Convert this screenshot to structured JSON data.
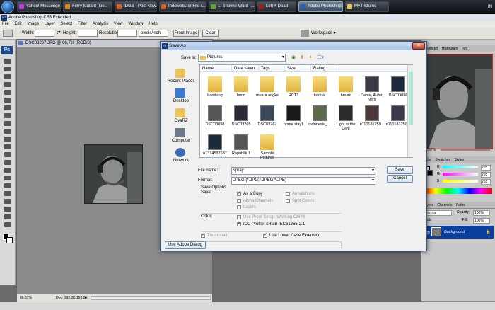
{
  "taskbar": {
    "buttons": [
      {
        "label": "Yahoo! Messenger",
        "color": "#c43ad6"
      },
      {
        "label": "Ferry Mutant (loe...",
        "color": "#e08a20"
      },
      {
        "label": "IDGS - Post New T...",
        "color": "#e06020"
      },
      {
        "label": "Indowebster File s...",
        "color": "#e06020"
      },
      {
        "label": "1. Shayne Ward -...",
        "color": "#60a030"
      },
      {
        "label": "Left 4 Dead",
        "color": "#a02020"
      },
      {
        "label": "Adobe Photoshop...",
        "color": "#2a5fb0"
      },
      {
        "label": "My Pictures",
        "color": "#e8c65a"
      }
    ],
    "tray": "IN"
  },
  "app": {
    "title": "Adobe Photoshop CS3 Extended",
    "menu": [
      "File",
      "Edit",
      "Image",
      "Layer",
      "Select",
      "Filter",
      "Analysis",
      "View",
      "Window",
      "Help"
    ],
    "options": {
      "width_label": "Width:",
      "height_label": "Height:",
      "resolution_label": "Resolution:",
      "resolution_unit": "pixels/inch",
      "front_image": "Front Image",
      "clear": "Clear",
      "workspace": "Workspace ▾"
    }
  },
  "document": {
    "title": "DSC03267.JPG @ 66,7% (RGB/8)",
    "zoom": "66,67%",
    "doc_info": "Doc: 192,0K/192,0K"
  },
  "panels": {
    "navigator_tabs": [
      "Navigator",
      "Histogram",
      "Info"
    ],
    "navigator_zoom": "66,67%",
    "color_tabs": [
      "Color",
      "Swatches",
      "Styles"
    ],
    "color_values": [
      {
        "channel": "R",
        "value": "255"
      },
      {
        "channel": "G",
        "value": "255"
      },
      {
        "channel": "B",
        "value": "255"
      }
    ],
    "layer_tabs": [
      "Layers",
      "Channels",
      "Paths"
    ],
    "layer_mode": "Normal",
    "opacity_label": "Opacity:",
    "opacity_value": "100%",
    "lock_label": "Lock:",
    "fill_label": "Fill:",
    "fill_value": "100%",
    "layer_name": "Background"
  },
  "dialog": {
    "title": "Save As",
    "save_in_label": "Save in:",
    "save_in_value": "Pictures",
    "places": [
      "Recent Places",
      "Desktop",
      "OvaRZ",
      "Computer",
      "Network"
    ],
    "columns": [
      "Name",
      "Date taken",
      "Tags",
      "Size",
      "Rating"
    ],
    "files": [
      {
        "name": "bandung",
        "kind": "folder"
      },
      {
        "name": "hmm",
        "kind": "folder"
      },
      {
        "name": "muara angke",
        "kind": "folder"
      },
      {
        "name": "RCT3",
        "kind": "folder"
      },
      {
        "name": "tutorial",
        "kind": "folder"
      },
      {
        "name": "tweak",
        "kind": "folder"
      },
      {
        "name": "Dante, Aufar, Nero",
        "kind": "photo"
      },
      {
        "name": "DSC03096",
        "kind": "photo"
      },
      {
        "name": "DSC03098",
        "kind": "photo"
      },
      {
        "name": "DSC03265",
        "kind": "photo"
      },
      {
        "name": "DSC03267",
        "kind": "photo"
      },
      {
        "name": "home stay1",
        "kind": "photo"
      },
      {
        "name": "indonesia_...",
        "kind": "photo"
      },
      {
        "name": "Light in the Dark",
        "kind": "photo"
      },
      {
        "name": "n110181259...",
        "kind": "photo"
      },
      {
        "name": "n110181259...",
        "kind": "photo"
      },
      {
        "name": "n1314537687",
        "kind": "photo"
      },
      {
        "name": "Republik 1",
        "kind": "photo"
      },
      {
        "name": "Sample Pictures",
        "kind": "folder"
      }
    ],
    "file_name_label": "File name:",
    "file_name_value": "spray",
    "format_label": "Format:",
    "format_value": "JPEG (*.JPG;*.JPEG;*.JPE)",
    "save": "Save",
    "cancel": "Cancel",
    "save_options_title": "Save Options",
    "save_label": "Save:",
    "as_a_copy": "As a Copy",
    "annotations": "Annotations",
    "alpha_channels": "Alpha Channels",
    "spot_colors": "Spot Colors",
    "layers": "Layers",
    "color_label": "Color:",
    "use_proof": "Use Proof Setup:  Working CMYK",
    "icc_profile": "ICC Profile:  sRGB IEC61966-2.1",
    "thumbnail": "Thumbnail",
    "lower_case": "Use Lower Case Extension",
    "use_adobe_dialog": "Use Adobe Dialog"
  }
}
